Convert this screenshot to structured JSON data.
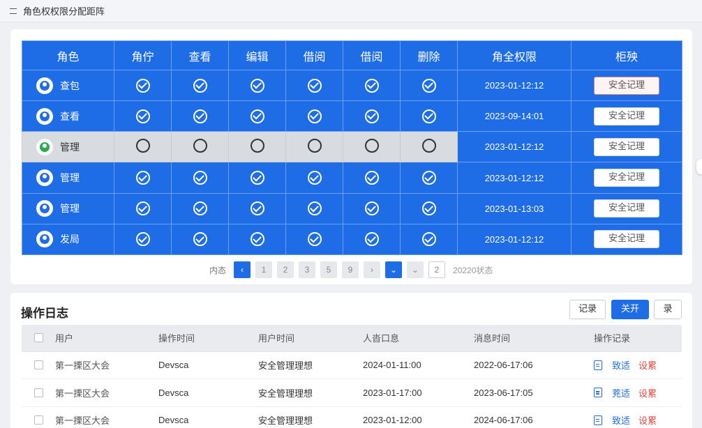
{
  "header": {
    "title": "角色权权限分配距阵"
  },
  "matrix": {
    "columns": [
      "角色",
      "角佇",
      "查看",
      "编辑",
      "借阅",
      "借阅",
      "删除",
      "角全权限",
      "柜殃"
    ],
    "rows": [
      {
        "name": "查包",
        "icon": "user-icon",
        "perms": [
          true,
          true,
          true,
          true,
          true,
          true
        ],
        "date": "2023-01-12:12",
        "action": "安全记理",
        "action_highlight": true,
        "gray": false
      },
      {
        "name": "查看",
        "icon": "user-icon",
        "perms": [
          true,
          true,
          true,
          true,
          true,
          true
        ],
        "date": "2023-09-14:01",
        "action": "安全记理",
        "action_highlight": false,
        "gray": false
      },
      {
        "name": "管理",
        "icon": "shield-user-icon",
        "perms": [
          false,
          false,
          false,
          false,
          false,
          false
        ],
        "date": "2023-01-12:12",
        "action": "安全记理",
        "action_highlight": false,
        "gray": true
      },
      {
        "name": "管理",
        "icon": "user-icon",
        "perms": [
          true,
          true,
          true,
          true,
          true,
          true
        ],
        "date": "2023-01-12:12",
        "action": "安全记理",
        "action_highlight": false,
        "gray": false
      },
      {
        "name": "管理",
        "icon": "user-icon",
        "perms": [
          true,
          true,
          true,
          true,
          true,
          true
        ],
        "date": "2023-01-13:03",
        "action": "安全记理",
        "action_highlight": false,
        "gray": false
      },
      {
        "name": "发局",
        "icon": "user-icon",
        "perms": [
          true,
          true,
          true,
          true,
          true,
          true
        ],
        "date": "2023-01-12:12",
        "action": "安全记理",
        "action_highlight": false,
        "gray": false
      }
    ]
  },
  "pager": {
    "label": "内态",
    "prev": "‹",
    "pages": [
      "1",
      "2",
      "3",
      "5",
      "9"
    ],
    "next": "›",
    "dropdown": "⌄",
    "dropdown2": "⌄",
    "current": "2",
    "total": "20220状态"
  },
  "log": {
    "title": "操作日志",
    "buttons": {
      "record": "记录",
      "close": "关开",
      "log": "录"
    },
    "columns": [
      "用户",
      "操作时间",
      "用户时间",
      "人沓口息",
      "消息时间",
      "操作记录"
    ],
    "rows": [
      {
        "user": "第一搮区大会",
        "op_time": "Devsca",
        "user_time": "安全管理理想",
        "info": "2024-01-11:00",
        "msg_time": "2022-06-17:06",
        "link1": "致适",
        "link2": "设累"
      },
      {
        "user": "第一搮区大会",
        "op_time": "Devsca",
        "user_time": "安全管理理想",
        "info": "2023-01-17:00",
        "msg_time": "2023-06-17:05",
        "link1": "茺适",
        "link2": "设累"
      },
      {
        "user": "第一搮区大会",
        "op_time": "Devsca",
        "user_time": "安全管理理想",
        "info": "2023-01-12:00",
        "msg_time": "2024-06-17:06",
        "link1": "致适",
        "link2": "设累"
      }
    ]
  },
  "colors": {
    "primary": "#1f6de6",
    "danger": "#e0473e",
    "row_gray": "#d8dbe0"
  }
}
